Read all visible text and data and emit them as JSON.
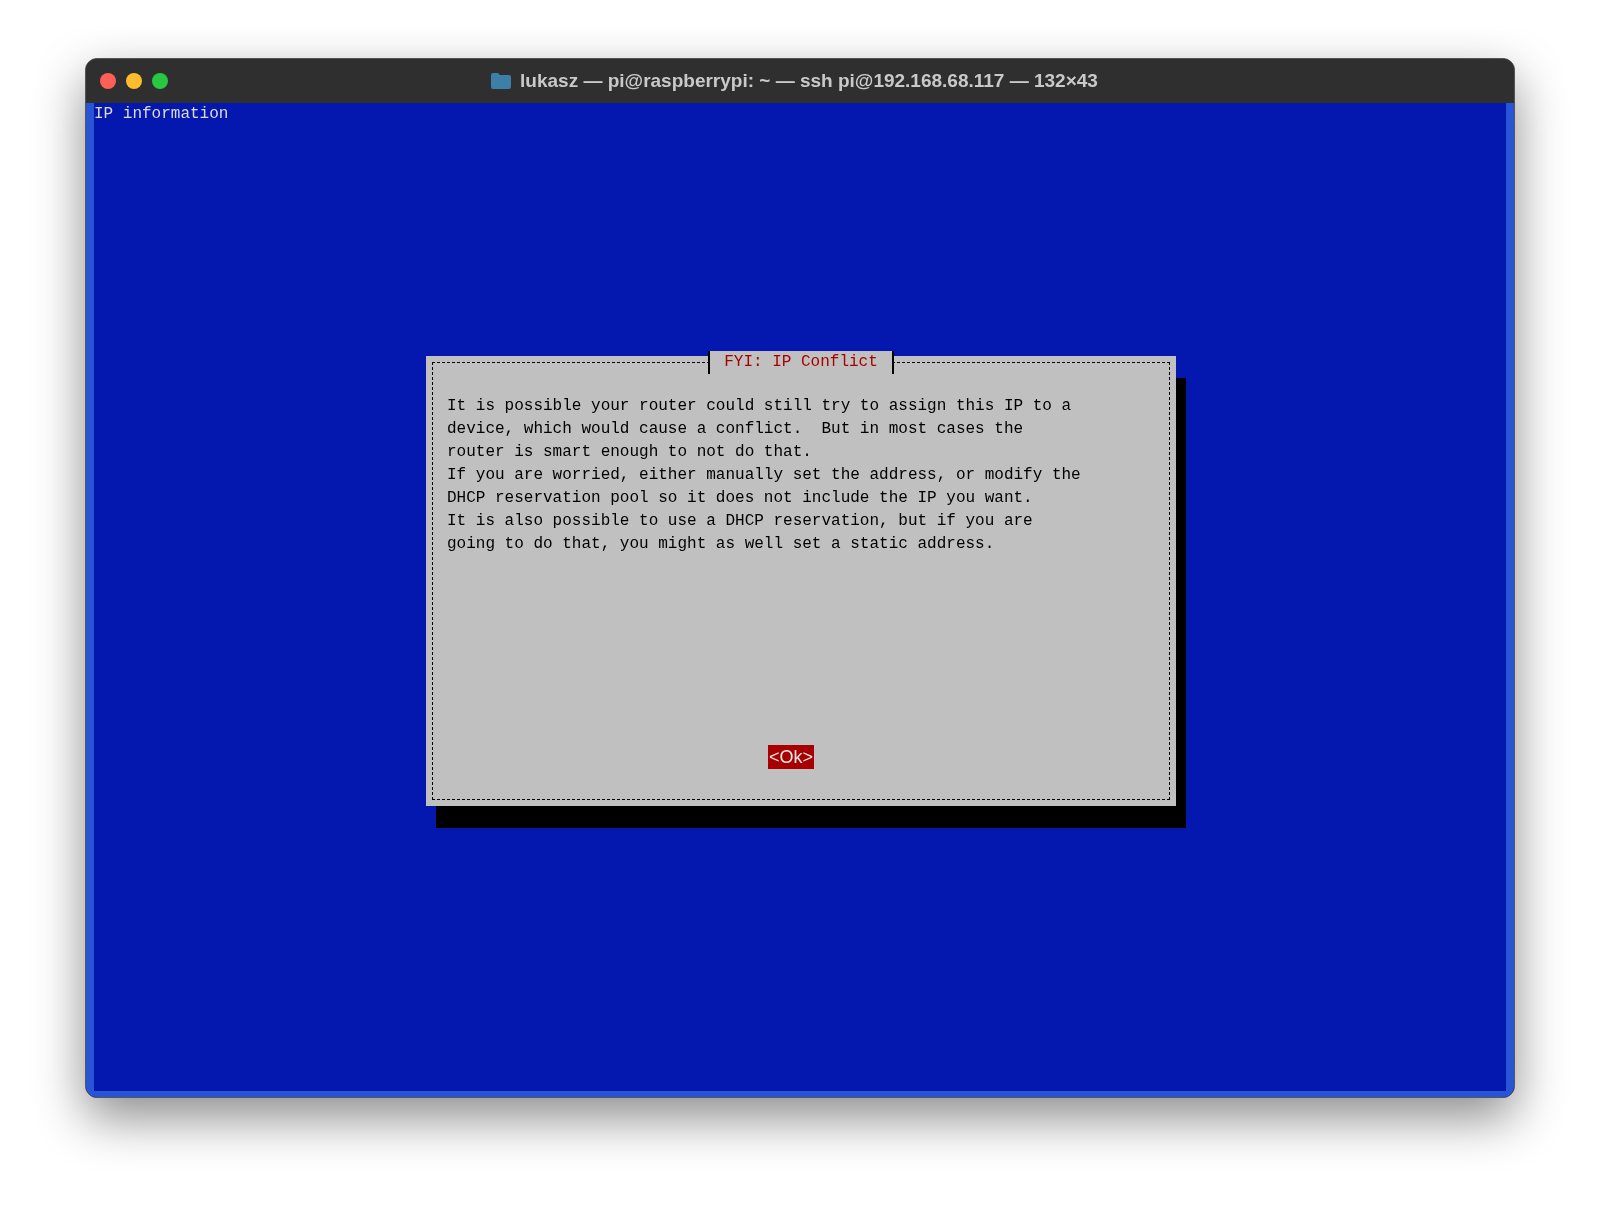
{
  "window": {
    "title": "lukasz — pi@raspberrypi: ~ — ssh pi@192.168.68.117 — 132×43"
  },
  "terminal": {
    "backtitle": "IP information"
  },
  "dialog": {
    "title": "FYI: IP Conflict",
    "message_lines": [
      "It is possible your router could still try to assign this IP to a",
      "device, which would cause a conflict.  But in most cases the",
      "router is smart enough to not do that.",
      "If you are worried, either manually set the address, or modify the",
      "DHCP reservation pool so it does not include the IP you want.",
      "It is also possible to use a DHCP reservation, but if you are",
      "going to do that, you might as well set a static address."
    ],
    "buttons": [
      {
        "label": "<Ok>",
        "selected": true
      }
    ]
  }
}
